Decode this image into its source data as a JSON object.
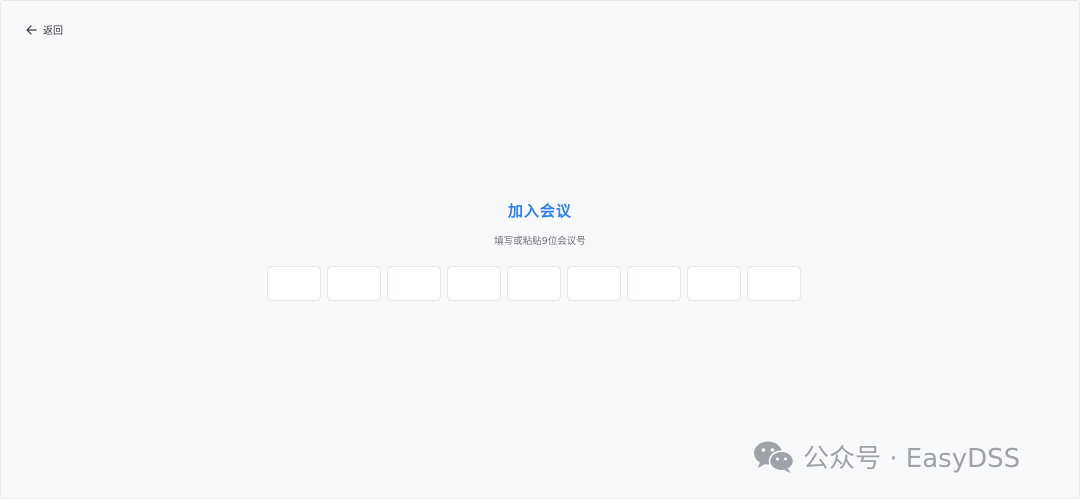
{
  "nav": {
    "back_label": "返回"
  },
  "join": {
    "title": "加入会议",
    "subtitle": "填写或粘贴9位会议号",
    "code_digits": [
      "",
      "",
      "",
      "",
      "",
      "",
      "",
      "",
      ""
    ]
  },
  "watermark": {
    "text": "公众号 · EasyDSS"
  },
  "colors": {
    "accent": "#2f80ed",
    "page_bg": "#f8f9fb",
    "input_border": "#e3e6ea"
  }
}
